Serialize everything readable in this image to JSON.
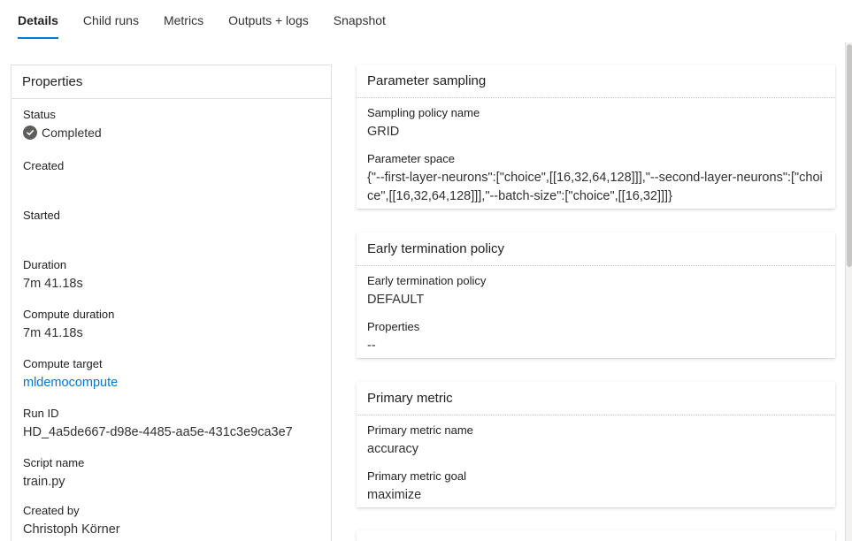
{
  "tabs": [
    {
      "label": "Details",
      "active": true
    },
    {
      "label": "Child runs",
      "active": false
    },
    {
      "label": "Metrics",
      "active": false
    },
    {
      "label": "Outputs + logs",
      "active": false
    },
    {
      "label": "Snapshot",
      "active": false
    }
  ],
  "properties": {
    "title": "Properties",
    "status_label": "Status",
    "status_value": "Completed",
    "created_label": "Created",
    "started_label": "Started",
    "duration_label": "Duration",
    "duration_value": "7m 41.18s",
    "compute_duration_label": "Compute duration",
    "compute_duration_value": "7m 41.18s",
    "compute_target_label": "Compute target",
    "compute_target_value": "mldemocompute",
    "run_id_label": "Run ID",
    "run_id_value": "HD_4a5de667-d98e-4485-aa5e-431c3e9ca3e7",
    "script_name_label": "Script name",
    "script_name_value": "train.py",
    "created_by_label": "Created by",
    "created_by_value": "Christoph Körner"
  },
  "parameter_sampling": {
    "title": "Parameter sampling",
    "policy_name_label": "Sampling policy name",
    "policy_name_value": "GRID",
    "space_label": "Parameter space",
    "space_value": "{\"--first-layer-neurons\":[\"choice\",[[16,32,64,128]]],\"--second-layer-neurons\":[\"choice\",[[16,32,64,128]]],\"--batch-size\":[\"choice\",[[16,32]]]}"
  },
  "early_termination": {
    "title": "Early termination policy",
    "policy_label": "Early termination policy",
    "policy_value": "DEFAULT",
    "properties_label": "Properties",
    "properties_value": "--"
  },
  "primary_metric": {
    "title": "Primary metric",
    "name_label": "Primary metric name",
    "name_value": "accuracy",
    "goal_label": "Primary metric goal",
    "goal_value": "maximize"
  },
  "colors": {
    "accent": "#0078d4",
    "status_icon": "#605e5c"
  },
  "icons": {
    "status": "checkmark-circle-icon"
  }
}
